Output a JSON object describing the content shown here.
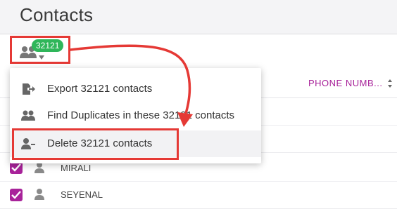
{
  "page": {
    "title": "Contacts"
  },
  "toolbar": {
    "count_badge": "32121"
  },
  "table": {
    "phone_header": "PHONE NUMB...",
    "rows": [
      {
        "name": "MIRALI"
      },
      {
        "name": "SEYENAL"
      }
    ]
  },
  "menu": {
    "items": [
      {
        "label": "Export 32121 contacts",
        "icon": "export-icon"
      },
      {
        "label": "Find Duplicates in these 32121 contacts",
        "icon": "people-icon"
      },
      {
        "label": "Delete 32121 contacts",
        "icon": "person-remove-icon"
      }
    ]
  },
  "colors": {
    "accent": "#a8239a",
    "badge": "#2fb65a",
    "annotation": "#e53935"
  }
}
